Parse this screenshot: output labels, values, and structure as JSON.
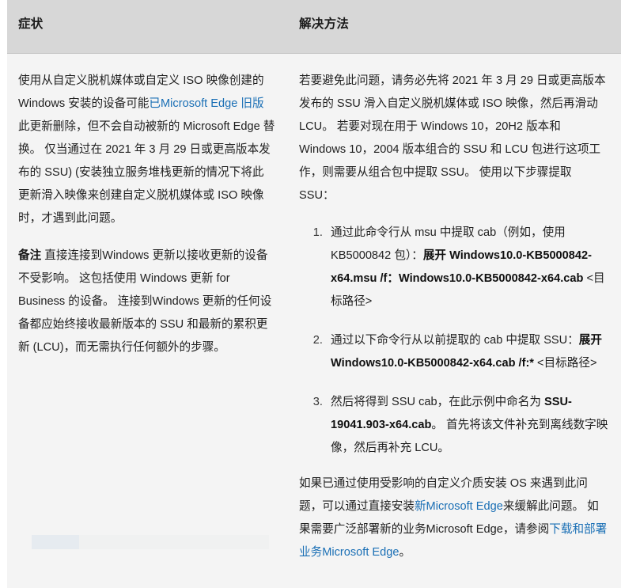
{
  "table": {
    "columns": [
      {
        "key": "symptom",
        "header": "症状"
      },
      {
        "key": "solution",
        "header": "解决方法"
      }
    ],
    "colors": {
      "header_background": "#d7d7d7",
      "body_background": "#f4f4f4",
      "page_background": "#ffffff",
      "text": "#1f1f1f",
      "link": "#1a6fb5",
      "header_border": "#c6c6c6"
    }
  },
  "symptom": {
    "paragraph_1": {
      "before_link": "使用从自定义脱机媒体或自定义 ISO 映像创建的 Windows 安装的设备可能",
      "link_text": "已Microsoft Edge 旧版",
      "after_link": "此更新删除，但不会自动被新的 Microsoft Edge 替换。 仅当通过在 2021 年 3 月 29 日或更高版本发布的 SSU) (安装独立服务堆栈更新的情况下将此更新滑入映像来创建自定义脱机媒体或 ISO 映像时，才遇到此问题。"
    },
    "paragraph_2": {
      "lead": "备注",
      "body": " 直接连接到Windows 更新以接收更新的设备不受影响。 这包括使用 Windows 更新 for Business 的设备。 连接到Windows 更新的任何设备都应始终接收最新版本的 SSU 和最新的累积更新 (LCU)，而无需执行任何额外的步骤。"
    }
  },
  "solution": {
    "intro": "若要避免此问题，请务必先将 2021 年 3 月 29 日或更高版本发布的 SSU 滑入自定义脱机媒体或 ISO 映像，然后再滑动 LCU。 若要对现在用于 Windows 10，20H2 版本和 Windows 10，2004 版本组合的 SSU 和 LCU 包进行这项工作，则需要从组合包中提取 SSU。 使用以下步骤提取 SSU：",
    "steps": [
      {
        "text": "通过此命令行从 msu 中提取 cab（例如，使用 KB5000842 包）：",
        "command": "展开 Windows10.0-KB5000842-x64.msu /f：Windows10.0-KB5000842-x64.cab",
        "trailing": " <目标路径>"
      },
      {
        "text": "通过以下命令行从以前提取的 cab 中提取 SSU：",
        "command": "展开 Windows10.0-KB5000842-x64.cab /f:*",
        "trailing": " <目标路径>"
      },
      {
        "text": "然后将得到 SSU cab，在此示例中命名为 ",
        "command": "SSU-19041.903-x64.cab",
        "trailing": "。 首先将该文件补充到离线数字映像，然后再补充 LCU。"
      }
    ],
    "closing": {
      "part_1": "如果已通过使用受影响的自定义介质安装 OS 来遇到此问题，可以通过直接安装",
      "link_1": "新Microsoft Edge",
      "part_2": "来缓解此问题。 如果需要广泛部署新的业务Microsoft Edge，请参阅",
      "link_2": "下载和部署业务Microsoft Edge",
      "part_3": "。"
    }
  }
}
